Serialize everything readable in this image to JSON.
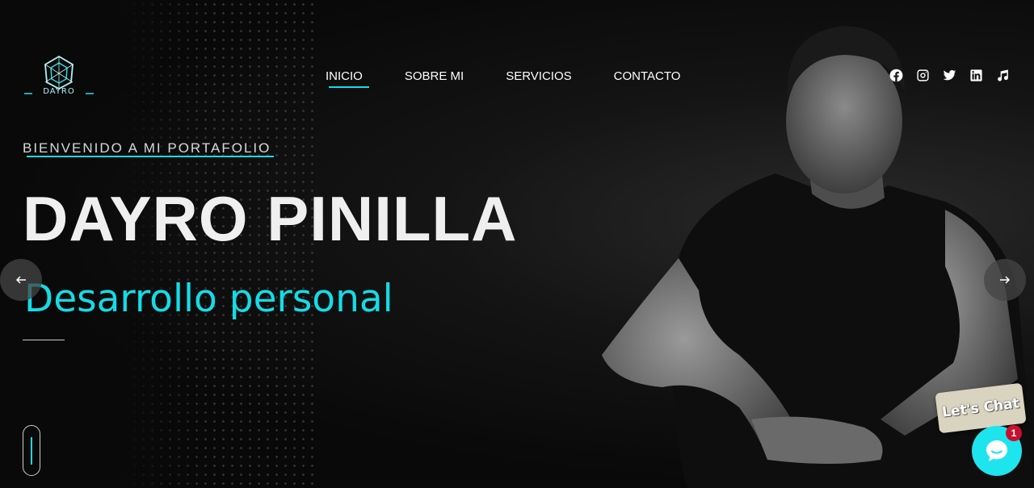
{
  "header": {
    "logo_text": "DAYRO",
    "nav": [
      {
        "label": "INICIO"
      },
      {
        "label": "SOBRE MI"
      },
      {
        "label": "SERVICIOS"
      },
      {
        "label": "CONTACTO"
      }
    ],
    "active_nav": "INICIO",
    "social_icons": [
      "facebook-icon",
      "instagram-icon",
      "twitter-icon",
      "linkedin-icon",
      "music-icon"
    ]
  },
  "hero": {
    "kicker": "BIENVENIDO A MI PORTAFOLIO",
    "name": "DAYRO PINILLA",
    "tagline": "Desarrollo personal"
  },
  "carousel": {
    "prev_icon": "arrow-left-icon",
    "next_icon": "arrow-right-icon"
  },
  "chat": {
    "label": "Let's Chat",
    "badge_count": "1"
  },
  "colors": {
    "accent": "#14dce6",
    "background": "#0a0a0a",
    "badge": "#c8102e"
  }
}
